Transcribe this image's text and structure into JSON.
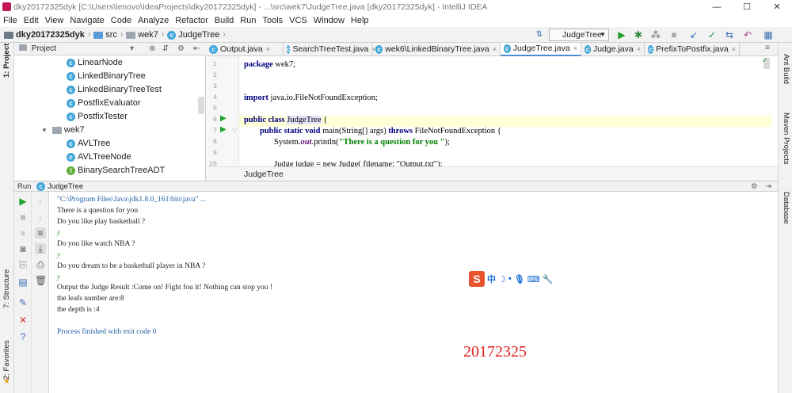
{
  "window": {
    "title": "dky20172325dyk [C:\\Users\\lenovo\\IdeaProjects\\dky20172325dyk] - ...\\src\\wek7\\JudgeTree.java [dky20172325dyk] - IntelliJ IDEA",
    "minimize": "—",
    "maximize": "☐",
    "close": "✕"
  },
  "menu": [
    "File",
    "Edit",
    "View",
    "Navigate",
    "Code",
    "Analyze",
    "Refactor",
    "Build",
    "Run",
    "Tools",
    "VCS",
    "Window",
    "Help"
  ],
  "breadcrumb": {
    "project": "dky20172325dyk",
    "src": "src",
    "pkg": "wek7",
    "cls": "JudgeTree"
  },
  "run_config": "JudgeTree",
  "left_strip": {
    "project": "1: Project",
    "structure": "7: Structure",
    "favorites": "2: Favorites"
  },
  "right_strip": {
    "ant": "Ant Build",
    "maven": "Maven Projects",
    "database": "Database"
  },
  "project_panel": {
    "title": "Project",
    "items": [
      "LinearNode",
      "LinkedBinaryTree",
      "LinkedBinaryTreeTest",
      "PostfixEvaluator",
      "PostfixTester",
      "wek7",
      "AVLTree",
      "AVLTreeNode",
      "BinarySearchTreeADT"
    ]
  },
  "tabs": [
    "Output.java",
    "SearchTreeTest.java",
    "wek6\\LinkedBinaryTree.java",
    "JudgeTree.java",
    "Judge.java",
    "PrefixToPostfix.java"
  ],
  "code": {
    "line_numbers": [
      "1",
      "2",
      "3",
      "4",
      "5",
      "6",
      "7",
      "8",
      "9",
      "10"
    ],
    "l1_kw": "package",
    "l1_rest": " wek7;",
    "l4_kw": "import",
    "l4_rest": " java.io.FileNotFoundException;",
    "l6_kw": "public class ",
    "l6_name": "JudgeTree",
    "l6_rest": " {",
    "l7_kw": "public static void ",
    "l7_a": "main(String[] args) ",
    "l7_kw2": "throws",
    "l7_b": " FileNotFoundException {",
    "l8_a": "System.",
    "l8_out": "out",
    "l8_b": ".println(",
    "l8_str": "\"There is a question for you \"",
    "l8_c": ");",
    "l10": "Judge judge = new Judge( filename: \"Output.txt\");"
  },
  "editor_crumb": "JudgeTree",
  "run_panel": {
    "label": "Run",
    "config": "JudgeTree"
  },
  "console": [
    {
      "t": "\"C:\\Program Files\\Java\\jdk1.8.0_161\\bin\\java\" ...",
      "k": "cmd"
    },
    {
      "t": "There is a question for you",
      "k": "out"
    },
    {
      "t": "Do you like play basketball ?",
      "k": "out"
    },
    {
      "t": "y",
      "k": "inp"
    },
    {
      "t": "Do you like watch NBA ?",
      "k": "out"
    },
    {
      "t": "y",
      "k": "inp"
    },
    {
      "t": "Do you dream to be a basketball player in NBA ?",
      "k": "out"
    },
    {
      "t": "y",
      "k": "inp"
    },
    {
      "t": "Output the Judge Result :Come on! Fight fou it! Nothing can stop you !",
      "k": "out"
    },
    {
      "t": "the leafs number are:8",
      "k": "out"
    },
    {
      "t": "the depth is :4",
      "k": "out"
    },
    {
      "t": "",
      "k": "out"
    },
    {
      "t": "Process finished with exit code 0",
      "k": "exit"
    }
  ],
  "ime": {
    "logo": "S",
    "mode": "中"
  },
  "stamp": "20172325",
  "colors": {
    "accent": "#4a8cd8",
    "class_icon": "#41a6d8",
    "run_green": "#1fa12c",
    "stamp_red": "#e02020",
    "ime_orange": "#e8522d"
  }
}
